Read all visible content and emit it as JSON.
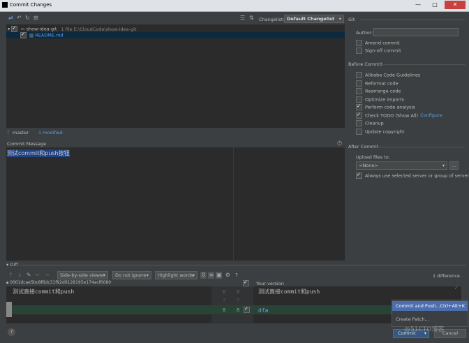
{
  "window": {
    "title": "Commit Changes"
  },
  "toolbar": {
    "changelist_label": "Changelist:",
    "changelist_value": "Default Changelist"
  },
  "tree": {
    "root_name": "show-idea-git",
    "root_info": "1 file  E:\\CloudCode\\show-idea-git",
    "file_name": "README.md"
  },
  "status": {
    "branch": "master",
    "modified": "1 modified"
  },
  "commit_message": {
    "label": "Commit Message",
    "text": "测试commit和push按钮"
  },
  "git": {
    "section": "Git",
    "author_label": "Author:",
    "amend": "Amend commit",
    "signoff": "Sign-off commit"
  },
  "before_commit": {
    "section": "Before Commit",
    "items": [
      {
        "label": "Alibaba Code Guidelines",
        "checked": false
      },
      {
        "label": "Reformat code",
        "checked": false
      },
      {
        "label": "Rearrange code",
        "checked": false
      },
      {
        "label": "Optimize imports",
        "checked": false
      },
      {
        "label": "Perform code analysis",
        "checked": true
      },
      {
        "label": "Check TODO (Show All)",
        "checked": true
      },
      {
        "label": "Cleanup",
        "checked": false
      },
      {
        "label": "Update copyright",
        "checked": false
      }
    ],
    "configure": "Configure"
  },
  "after_commit": {
    "section": "After Commit",
    "upload_label": "Upload files to:",
    "upload_value": "<None>",
    "browse": "...",
    "always_use": "Always use selected server or group of servers"
  },
  "diff": {
    "label": "Diff",
    "viewer": "Side-by-side viewer",
    "ignore": "Do not ignore",
    "highlight": "Highlight words",
    "help": "?",
    "count": "1 difference",
    "left_title": "0001dcae5bc8f6dc31f92d6128195e174acf6080",
    "right_title": "Your version",
    "left_line1": "测试直接commit和push",
    "right_line1": "测试直接commit和push",
    "right_line2": "dfa",
    "gutter": [
      "6",
      "6",
      "7",
      "7",
      "8",
      "8"
    ]
  },
  "popup": {
    "commit_push": "Commit and Push...",
    "shortcut": "Ctrl+Alt+K",
    "create_patch": "Create Patch..."
  },
  "buttons": {
    "commit": "Commit",
    "cancel": "Cancel",
    "help": "?"
  },
  "watermark": "@51CTO博客",
  "colors": {
    "accent": "#4b6eaf",
    "link": "#589df6",
    "bg": "#3c3f41",
    "editor": "#2b2b2b"
  }
}
